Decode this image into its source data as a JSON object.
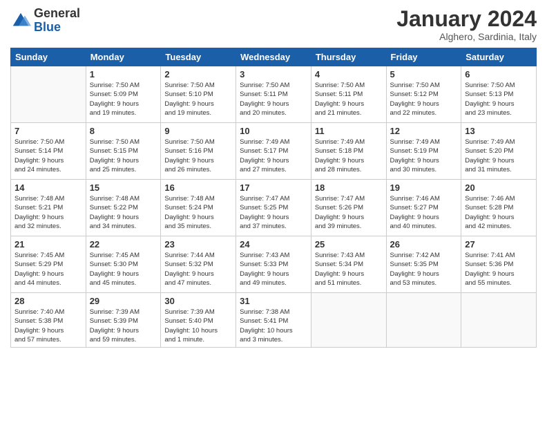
{
  "logo": {
    "general": "General",
    "blue": "Blue"
  },
  "header": {
    "month": "January 2024",
    "location": "Alghero, Sardinia, Italy"
  },
  "weekdays": [
    "Sunday",
    "Monday",
    "Tuesday",
    "Wednesday",
    "Thursday",
    "Friday",
    "Saturday"
  ],
  "weeks": [
    [
      {
        "day": "",
        "info": ""
      },
      {
        "day": "1",
        "info": "Sunrise: 7:50 AM\nSunset: 5:09 PM\nDaylight: 9 hours\nand 19 minutes."
      },
      {
        "day": "2",
        "info": "Sunrise: 7:50 AM\nSunset: 5:10 PM\nDaylight: 9 hours\nand 19 minutes."
      },
      {
        "day": "3",
        "info": "Sunrise: 7:50 AM\nSunset: 5:11 PM\nDaylight: 9 hours\nand 20 minutes."
      },
      {
        "day": "4",
        "info": "Sunrise: 7:50 AM\nSunset: 5:11 PM\nDaylight: 9 hours\nand 21 minutes."
      },
      {
        "day": "5",
        "info": "Sunrise: 7:50 AM\nSunset: 5:12 PM\nDaylight: 9 hours\nand 22 minutes."
      },
      {
        "day": "6",
        "info": "Sunrise: 7:50 AM\nSunset: 5:13 PM\nDaylight: 9 hours\nand 23 minutes."
      }
    ],
    [
      {
        "day": "7",
        "info": "Sunrise: 7:50 AM\nSunset: 5:14 PM\nDaylight: 9 hours\nand 24 minutes."
      },
      {
        "day": "8",
        "info": "Sunrise: 7:50 AM\nSunset: 5:15 PM\nDaylight: 9 hours\nand 25 minutes."
      },
      {
        "day": "9",
        "info": "Sunrise: 7:50 AM\nSunset: 5:16 PM\nDaylight: 9 hours\nand 26 minutes."
      },
      {
        "day": "10",
        "info": "Sunrise: 7:49 AM\nSunset: 5:17 PM\nDaylight: 9 hours\nand 27 minutes."
      },
      {
        "day": "11",
        "info": "Sunrise: 7:49 AM\nSunset: 5:18 PM\nDaylight: 9 hours\nand 28 minutes."
      },
      {
        "day": "12",
        "info": "Sunrise: 7:49 AM\nSunset: 5:19 PM\nDaylight: 9 hours\nand 30 minutes."
      },
      {
        "day": "13",
        "info": "Sunrise: 7:49 AM\nSunset: 5:20 PM\nDaylight: 9 hours\nand 31 minutes."
      }
    ],
    [
      {
        "day": "14",
        "info": "Sunrise: 7:48 AM\nSunset: 5:21 PM\nDaylight: 9 hours\nand 32 minutes."
      },
      {
        "day": "15",
        "info": "Sunrise: 7:48 AM\nSunset: 5:22 PM\nDaylight: 9 hours\nand 34 minutes."
      },
      {
        "day": "16",
        "info": "Sunrise: 7:48 AM\nSunset: 5:24 PM\nDaylight: 9 hours\nand 35 minutes."
      },
      {
        "day": "17",
        "info": "Sunrise: 7:47 AM\nSunset: 5:25 PM\nDaylight: 9 hours\nand 37 minutes."
      },
      {
        "day": "18",
        "info": "Sunrise: 7:47 AM\nSunset: 5:26 PM\nDaylight: 9 hours\nand 39 minutes."
      },
      {
        "day": "19",
        "info": "Sunrise: 7:46 AM\nSunset: 5:27 PM\nDaylight: 9 hours\nand 40 minutes."
      },
      {
        "day": "20",
        "info": "Sunrise: 7:46 AM\nSunset: 5:28 PM\nDaylight: 9 hours\nand 42 minutes."
      }
    ],
    [
      {
        "day": "21",
        "info": "Sunrise: 7:45 AM\nSunset: 5:29 PM\nDaylight: 9 hours\nand 44 minutes."
      },
      {
        "day": "22",
        "info": "Sunrise: 7:45 AM\nSunset: 5:30 PM\nDaylight: 9 hours\nand 45 minutes."
      },
      {
        "day": "23",
        "info": "Sunrise: 7:44 AM\nSunset: 5:32 PM\nDaylight: 9 hours\nand 47 minutes."
      },
      {
        "day": "24",
        "info": "Sunrise: 7:43 AM\nSunset: 5:33 PM\nDaylight: 9 hours\nand 49 minutes."
      },
      {
        "day": "25",
        "info": "Sunrise: 7:43 AM\nSunset: 5:34 PM\nDaylight: 9 hours\nand 51 minutes."
      },
      {
        "day": "26",
        "info": "Sunrise: 7:42 AM\nSunset: 5:35 PM\nDaylight: 9 hours\nand 53 minutes."
      },
      {
        "day": "27",
        "info": "Sunrise: 7:41 AM\nSunset: 5:36 PM\nDaylight: 9 hours\nand 55 minutes."
      }
    ],
    [
      {
        "day": "28",
        "info": "Sunrise: 7:40 AM\nSunset: 5:38 PM\nDaylight: 9 hours\nand 57 minutes."
      },
      {
        "day": "29",
        "info": "Sunrise: 7:39 AM\nSunset: 5:39 PM\nDaylight: 9 hours\nand 59 minutes."
      },
      {
        "day": "30",
        "info": "Sunrise: 7:39 AM\nSunset: 5:40 PM\nDaylight: 10 hours\nand 1 minute."
      },
      {
        "day": "31",
        "info": "Sunrise: 7:38 AM\nSunset: 5:41 PM\nDaylight: 10 hours\nand 3 minutes."
      },
      {
        "day": "",
        "info": ""
      },
      {
        "day": "",
        "info": ""
      },
      {
        "day": "",
        "info": ""
      }
    ]
  ]
}
